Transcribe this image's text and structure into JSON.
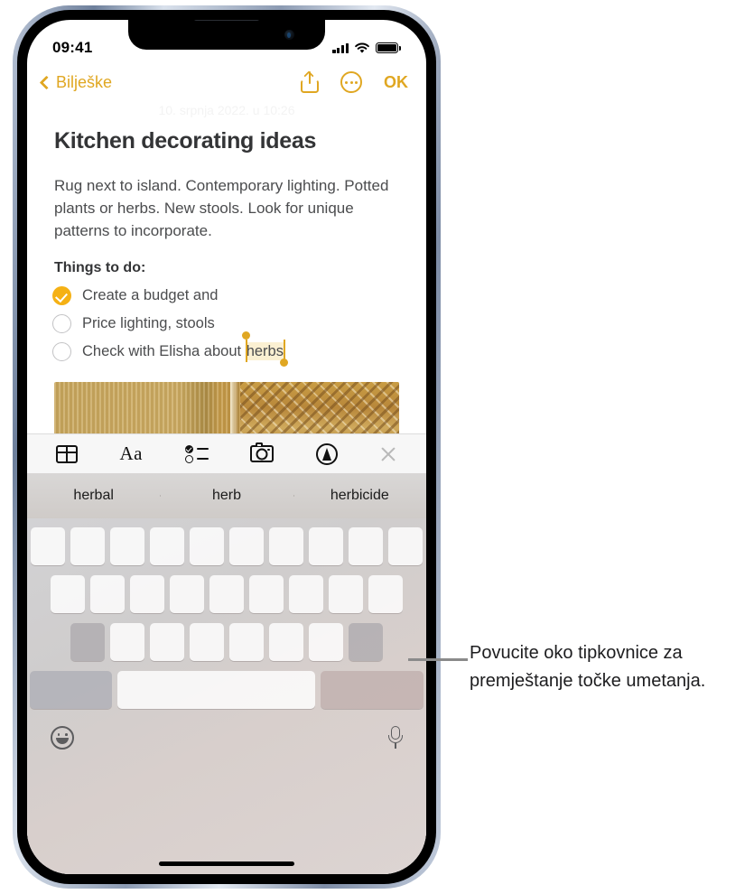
{
  "status_bar": {
    "time": "09:41",
    "cellular": "signal-bars",
    "wifi": "wifi-icon",
    "battery": "battery-full"
  },
  "nav_bar": {
    "back_label": "Bilješke",
    "share_icon": "share-icon",
    "more_icon": "more-circle-icon",
    "done_label": "OK"
  },
  "note": {
    "date": "10. srpnja 2022. u 10:26",
    "title": "Kitchen decorating ideas",
    "body": "Rug next to island. Contemporary lighting. Potted plants or herbs. New stools. Look for unique patterns to incorporate.",
    "todo_heading": "Things to do:",
    "todos": [
      {
        "checked": true,
        "text": "Create a budget and"
      },
      {
        "checked": false,
        "text": "Price lighting, stools"
      },
      {
        "checked": false,
        "text_before": "Check with Elisha about ",
        "selected_word": "herbs"
      }
    ],
    "attachment": "photo-attachment"
  },
  "format_toolbar": {
    "items": [
      {
        "name": "table-icon",
        "label": ""
      },
      {
        "name": "text-format-icon",
        "label": "Aa"
      },
      {
        "name": "checklist-icon",
        "label": ""
      },
      {
        "name": "camera-icon",
        "label": ""
      },
      {
        "name": "markup-pen-icon",
        "label": ""
      },
      {
        "name": "close-icon",
        "label": ""
      }
    ]
  },
  "keyboard": {
    "suggestions": [
      "herbal",
      "herb",
      "herbicide"
    ],
    "emoji_icon": "emoji-icon",
    "dictation_icon": "microphone-icon",
    "row1_keys": 10,
    "row2_keys": 9,
    "row3_keys": 7
  },
  "callout": {
    "text": "Povucite oko tipkovnice za premještanje točke umetanja."
  },
  "colors": {
    "accent": "#E0A722",
    "checkbox_checked": "#F5B115",
    "selection_highlight": "#FBF0D2",
    "text_primary": "#333436",
    "text_body": "#4b4c4e"
  }
}
